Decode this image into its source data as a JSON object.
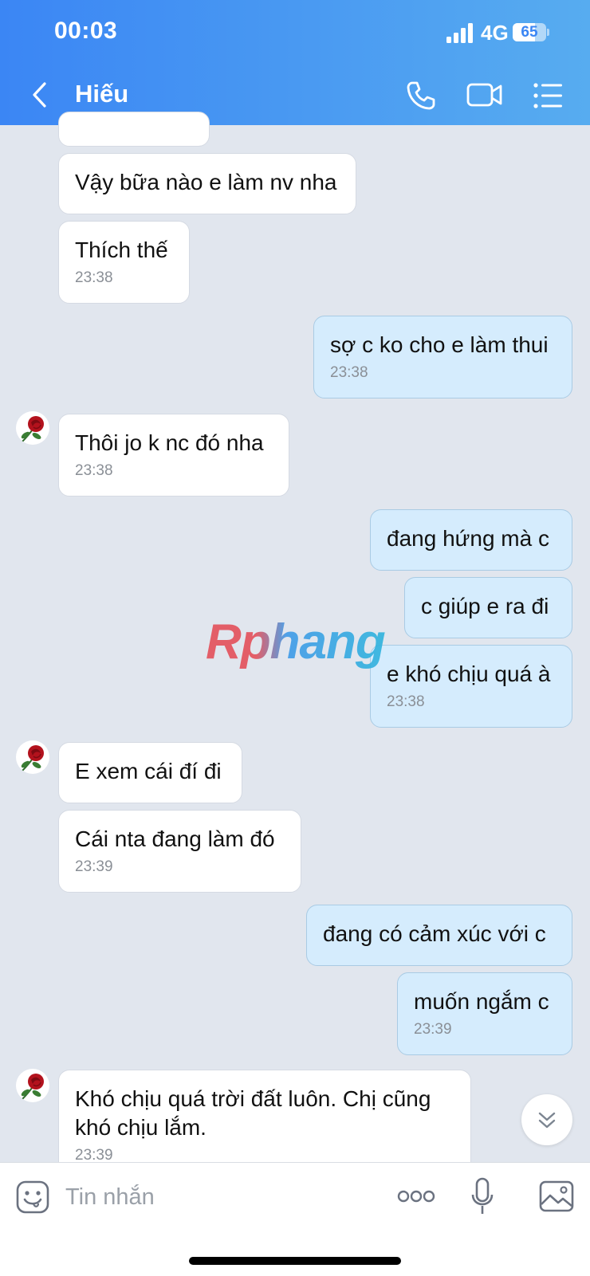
{
  "status_bar": {
    "time": "00:03",
    "network": "4G",
    "battery": "65"
  },
  "header": {
    "title": "Hiếu",
    "icons": [
      "back-icon",
      "phone-icon",
      "video-icon",
      "menu-icon"
    ]
  },
  "messages": [
    {
      "text": "Vậy bữa nào e làm nv nha",
      "time": ""
    },
    {
      "text": "Thích thế",
      "time": "23:38"
    },
    {
      "text": "sợ c ko cho e làm thui",
      "time": "23:38"
    },
    {
      "text": "Thôi jo k nc đó nha",
      "time": "23:38"
    },
    {
      "text": "đang hứng mà c",
      "time": ""
    },
    {
      "text": "c giúp e ra đi",
      "time": ""
    },
    {
      "text": "e khó chịu quá à",
      "time": "23:38"
    },
    {
      "text": "E xem cái đí đi",
      "time": ""
    },
    {
      "text": "Cái nta đang làm đó",
      "time": "23:39"
    },
    {
      "text": "đang có cảm xúc với c",
      "time": ""
    },
    {
      "text": "muốn ngắm c",
      "time": "23:39"
    },
    {
      "text": "Khó chịu quá trời đất luôn. Chị cũng khó chịu lắm.",
      "time": "23:39"
    }
  ],
  "watermark": "Rphang",
  "composer": {
    "placeholder": "Tin nhắn"
  }
}
